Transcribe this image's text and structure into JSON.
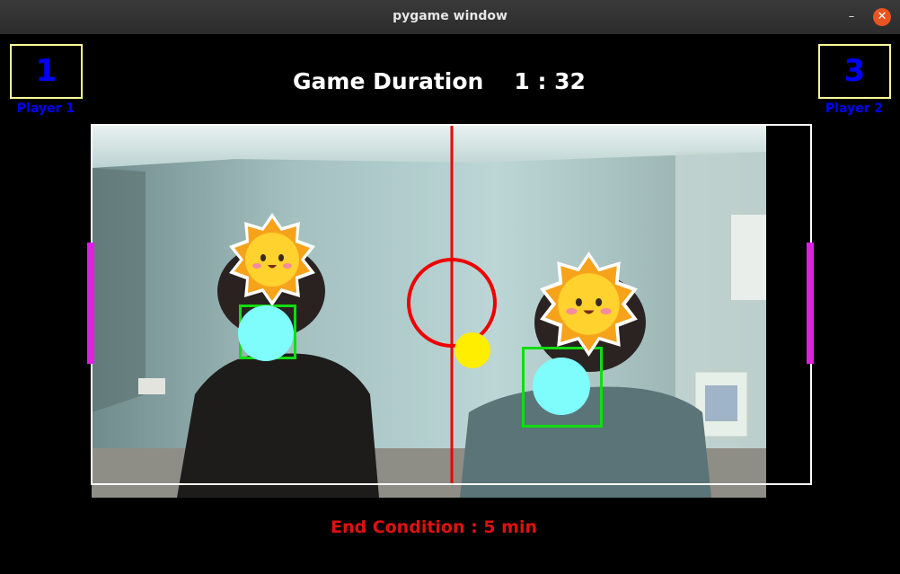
{
  "window": {
    "title": "pygame window",
    "minimize_glyph": "–",
    "close_glyph": "✕"
  },
  "game": {
    "title_label": "Game Duration",
    "time": "1 : 32",
    "end_condition": "End Condition :  5 min",
    "player1": {
      "label": "Player 1",
      "score": "1"
    },
    "player2": {
      "label": "Player 2",
      "score": "3"
    }
  },
  "icons": {
    "face_cover": "smiling-sun-icon",
    "ball": "yellow-ball",
    "hand_marker": "cyan-circle"
  },
  "colors": {
    "score": "#0000ff",
    "score_box_border": "#fdfd96",
    "center_line": "#ee0000",
    "paddle": "#e020e0",
    "ball": "#ffee00",
    "hand_box": "#10dd10",
    "hand_marker": "#7ffcfc",
    "end_condition": "#e01010"
  }
}
